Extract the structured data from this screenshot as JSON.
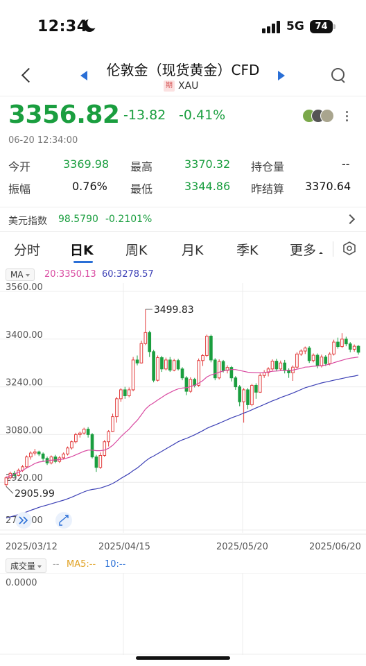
{
  "status_bar": {
    "time": "12:34",
    "network": "5G",
    "battery": "74"
  },
  "nav": {
    "title": "伦敦金（现货黄金）CFD",
    "futures_tag": "期",
    "symbol": "XAU"
  },
  "quote": {
    "price": "3356.82",
    "change": "-13.82",
    "change_pct": "-0.41%",
    "time": "06-20 12:34:00",
    "stats": [
      {
        "label": "今开",
        "value": "3369.98",
        "color": "green"
      },
      {
        "label": "最高",
        "value": "3370.32",
        "color": "green"
      },
      {
        "label": "持仓量",
        "value": "--",
        "color": "black"
      },
      {
        "label": "振幅",
        "value": "0.76%",
        "color": "black"
      },
      {
        "label": "最低",
        "value": "3344.86",
        "color": "green"
      },
      {
        "label": "昨结算",
        "value": "3370.64",
        "color": "black"
      }
    ]
  },
  "usd_index": {
    "label": "美元指数",
    "value": "98.5790",
    "change": "-0.2101%"
  },
  "tabs": [
    "分时",
    "日K",
    "周K",
    "月K",
    "季K",
    "更多"
  ],
  "active_tab": "日K",
  "indicators": {
    "main": "MA",
    "ma20": "20:3350.13",
    "ma60": "60:3278.57"
  },
  "volume": {
    "label": "成交量",
    "dash": "--",
    "ma5": "MA5:--",
    "ma10": "10:--",
    "axis_value": "0.0000"
  },
  "colors": {
    "up": "#e23b3b",
    "down": "#1a9e3f",
    "ma20": "#d94aa1",
    "ma60": "#3b3fb5",
    "accent": "#2a6fd6"
  },
  "chart_data": {
    "type": "candlestick",
    "y_ticks": [
      "3560.00",
      "3400.00",
      "3240.00",
      "3080.00",
      "2920.00",
      "2760.00"
    ],
    "ylim": [
      2760,
      3560
    ],
    "x_ticks": [
      "2025/03/12",
      "2025/04/15",
      "2025/05/20",
      "2025/06/20"
    ],
    "annotations": {
      "high": "3499.83",
      "low": "2905.99"
    },
    "candles": [
      [
        2912,
        2935,
        2906,
        2940
      ],
      [
        2935,
        2950,
        2930,
        2956
      ],
      [
        2950,
        2943,
        2938,
        2958
      ],
      [
        2943,
        2960,
        2940,
        2966
      ],
      [
        2960,
        2972,
        2955,
        2978
      ],
      [
        2972,
        3005,
        2968,
        3010
      ],
      [
        3005,
        3018,
        2996,
        3024
      ],
      [
        3018,
        3022,
        3010,
        3032
      ],
      [
        3022,
        3015,
        3008,
        3026
      ],
      [
        3015,
        3000,
        2990,
        3020
      ],
      [
        3000,
        2985,
        2978,
        3006
      ],
      [
        2985,
        3005,
        2980,
        3010
      ],
      [
        3005,
        2990,
        2984,
        3012
      ],
      [
        2990,
        3002,
        2985,
        3008
      ],
      [
        3002,
        3015,
        2996,
        3020
      ],
      [
        3015,
        3035,
        3010,
        3040
      ],
      [
        3035,
        3056,
        3030,
        3060
      ],
      [
        3056,
        3080,
        3050,
        3086
      ],
      [
        3080,
        3085,
        3070,
        3090
      ],
      [
        3085,
        3098,
        3080,
        3103
      ],
      [
        3098,
        3080,
        3070,
        3105
      ],
      [
        3080,
        3005,
        3000,
        3085
      ],
      [
        3005,
        2970,
        2955,
        3012
      ],
      [
        2970,
        3010,
        2965,
        3020
      ],
      [
        3010,
        3056,
        3005,
        3062
      ],
      [
        3056,
        3090,
        3040,
        3095
      ],
      [
        3090,
        3140,
        3088,
        3150
      ],
      [
        3140,
        3200,
        3120,
        3206
      ],
      [
        3200,
        3230,
        3190,
        3236
      ],
      [
        3230,
        3210,
        3200,
        3240
      ],
      [
        3210,
        3230,
        3205,
        3238
      ],
      [
        3230,
        3330,
        3225,
        3340
      ],
      [
        3330,
        3320,
        3312,
        3345
      ],
      [
        3320,
        3385,
        3318,
        3395
      ],
      [
        3385,
        3422,
        3380,
        3500
      ],
      [
        3422,
        3358,
        3340,
        3428
      ],
      [
        3358,
        3262,
        3255,
        3364
      ],
      [
        3262,
        3338,
        3258,
        3345
      ],
      [
        3338,
        3300,
        3290,
        3344
      ],
      [
        3300,
        3330,
        3295,
        3338
      ],
      [
        3330,
        3296,
        3290,
        3340
      ],
      [
        3296,
        3328,
        3292,
        3334
      ],
      [
        3328,
        3300,
        3295,
        3334
      ],
      [
        3300,
        3270,
        3262,
        3306
      ],
      [
        3270,
        3225,
        3212,
        3276
      ],
      [
        3225,
        3265,
        3220,
        3272
      ],
      [
        3265,
        3245,
        3238,
        3270
      ],
      [
        3245,
        3328,
        3240,
        3335
      ],
      [
        3328,
        3345,
        3310,
        3350
      ],
      [
        3345,
        3410,
        3340,
        3415
      ],
      [
        3410,
        3330,
        3322,
        3415
      ],
      [
        3330,
        3270,
        3262,
        3336
      ],
      [
        3270,
        3325,
        3265,
        3332
      ],
      [
        3325,
        3295,
        3288,
        3330
      ],
      [
        3295,
        3305,
        3285,
        3312
      ],
      [
        3305,
        3270,
        3258,
        3310
      ],
      [
        3270,
        3240,
        3230,
        3276
      ],
      [
        3240,
        3190,
        3175,
        3246
      ],
      [
        3190,
        3230,
        3120,
        3236
      ],
      [
        3230,
        3180,
        3165,
        3236
      ],
      [
        3180,
        3245,
        3175,
        3250
      ],
      [
        3245,
        3222,
        3200,
        3252
      ],
      [
        3222,
        3278,
        3220,
        3285
      ],
      [
        3278,
        3288,
        3270,
        3296
      ],
      [
        3288,
        3300,
        3275,
        3306
      ],
      [
        3300,
        3326,
        3294,
        3332
      ],
      [
        3326,
        3300,
        3292,
        3334
      ],
      [
        3300,
        3320,
        3294,
        3328
      ],
      [
        3320,
        3296,
        3285,
        3330
      ],
      [
        3296,
        3287,
        3270,
        3302
      ],
      [
        3287,
        3306,
        3260,
        3312
      ],
      [
        3306,
        3350,
        3300,
        3356
      ],
      [
        3350,
        3360,
        3344,
        3366
      ],
      [
        3360,
        3370,
        3350,
        3375
      ],
      [
        3370,
        3328,
        3320,
        3376
      ],
      [
        3328,
        3346,
        3322,
        3352
      ],
      [
        3346,
        3310,
        3302,
        3352
      ],
      [
        3310,
        3340,
        3305,
        3348
      ],
      [
        3340,
        3318,
        3310,
        3346
      ],
      [
        3318,
        3350,
        3312,
        3356
      ],
      [
        3350,
        3390,
        3345,
        3398
      ],
      [
        3390,
        3375,
        3368,
        3405
      ],
      [
        3375,
        3400,
        3370,
        3420
      ],
      [
        3400,
        3384,
        3376,
        3408
      ],
      [
        3384,
        3366,
        3356,
        3390
      ],
      [
        3366,
        3376,
        3358,
        3382
      ],
      [
        3376,
        3356,
        3348,
        3380
      ]
    ],
    "ma20": [
      2936,
      2942,
      2948,
      2954,
      2960,
      2968,
      2975,
      2983,
      2988,
      2990,
      2992,
      2994,
      2995,
      2996,
      2998,
      3002,
      3006,
      3012,
      3018,
      3024,
      3028,
      3028,
      3026,
      3026,
      3028,
      3034,
      3044,
      3058,
      3073,
      3086,
      3098,
      3114,
      3128,
      3146,
      3165,
      3178,
      3186,
      3196,
      3205,
      3214,
      3221,
      3228,
      3233,
      3236,
      3237,
      3241,
      3245,
      3252,
      3261,
      3273,
      3280,
      3284,
      3289,
      3293,
      3296,
      3298,
      3298,
      3295,
      3292,
      3289,
      3288,
      3287,
      3287,
      3288,
      3290,
      3292,
      3293,
      3294,
      3295,
      3295,
      3296,
      3299,
      3302,
      3306,
      3307,
      3309,
      3310,
      3311,
      3313,
      3316,
      3321,
      3325,
      3329,
      3333,
      3336,
      3338,
      3340
    ],
    "ma60": [
      2800,
      2804,
      2808,
      2812,
      2816,
      2821,
      2826,
      2831,
      2836,
      2840,
      2844,
      2848,
      2852,
      2856,
      2860,
      2865,
      2870,
      2876,
      2882,
      2888,
      2893,
      2896,
      2898,
      2901,
      2905,
      2910,
      2916,
      2924,
      2933,
      2941,
      2949,
      2959,
      2968,
      2979,
      2991,
      3001,
      3008,
      3016,
      3024,
      3032,
      3040,
      3048,
      3056,
      3062,
      3067,
      3073,
      3079,
      3086,
      3093,
      3101,
      3107,
      3112,
      3118,
      3124,
      3130,
      3136,
      3141,
      3146,
      3152,
      3157,
      3163,
      3169,
      3175,
      3181,
      3187,
      3193,
      3198,
      3204,
      3209,
      3214,
      3219,
      3225,
      3231,
      3237,
      3241,
      3245,
      3249,
      3253,
      3256,
      3259,
      3262,
      3265,
      3268,
      3271,
      3274,
      3276,
      3279
    ]
  }
}
